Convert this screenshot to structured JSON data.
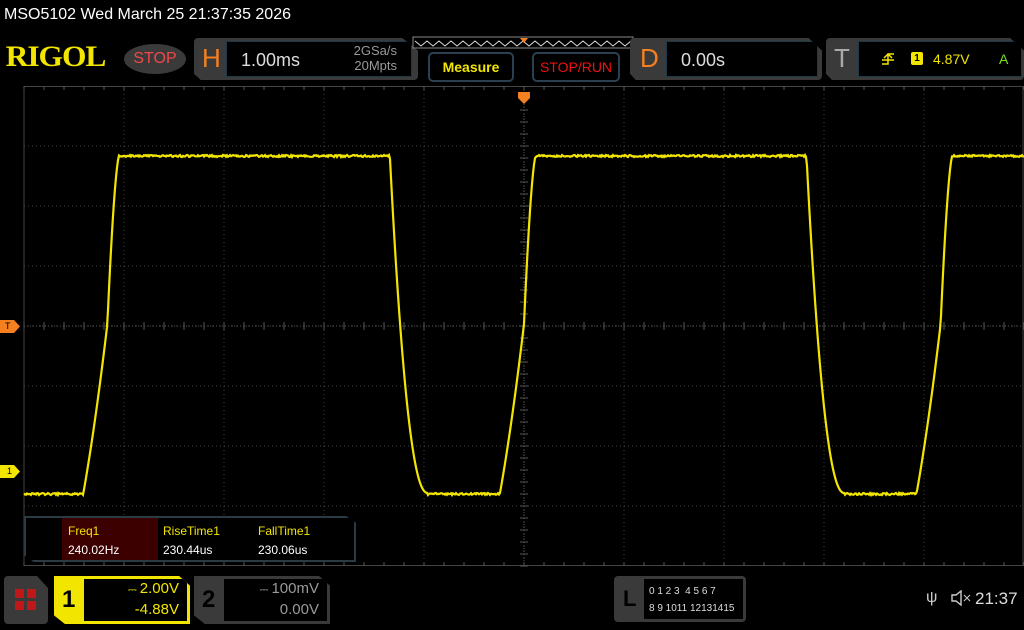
{
  "header": {
    "title": "MSO5102  Wed March 25 21:37:35 2026",
    "brand": "RIGOL",
    "run_state": "STOP"
  },
  "horizontal": {
    "letter": "H",
    "timebase": "1.00ms",
    "sample_rate": "2GSa/s",
    "memory_depth": "20Mpts"
  },
  "buttons": {
    "measure": "Measure",
    "stop_run": "STOP/RUN"
  },
  "delay": {
    "letter": "D",
    "value": "0.00s"
  },
  "trigger": {
    "letter": "T",
    "slope": "rising-edge-icon",
    "source": "1",
    "level": "4.87V",
    "mode": "A",
    "marker": "T"
  },
  "channel_marker": "1",
  "measurements": [
    {
      "label": "Freq1",
      "value": "240.02Hz"
    },
    {
      "label": "RiseTime1",
      "value": "230.44us"
    },
    {
      "label": "FallTime1",
      "value": "230.06us"
    }
  ],
  "channels": [
    {
      "num": "1",
      "scale": "2.00V",
      "offset": "-4.88V",
      "active": true
    },
    {
      "num": "2",
      "scale": "100mV",
      "offset": "0.00V",
      "active": false
    }
  ],
  "logic": {
    "letter": "L",
    "row1": "0 1 2 3  4 5 6 7",
    "row2": "8 9 1011 12131415"
  },
  "status": {
    "time": "21:37",
    "icons": [
      "usb-icon",
      "speaker-muted-icon"
    ]
  },
  "colors": {
    "ch1": "#f2e600",
    "accent": "#f58020",
    "stop": "#f04848"
  }
}
